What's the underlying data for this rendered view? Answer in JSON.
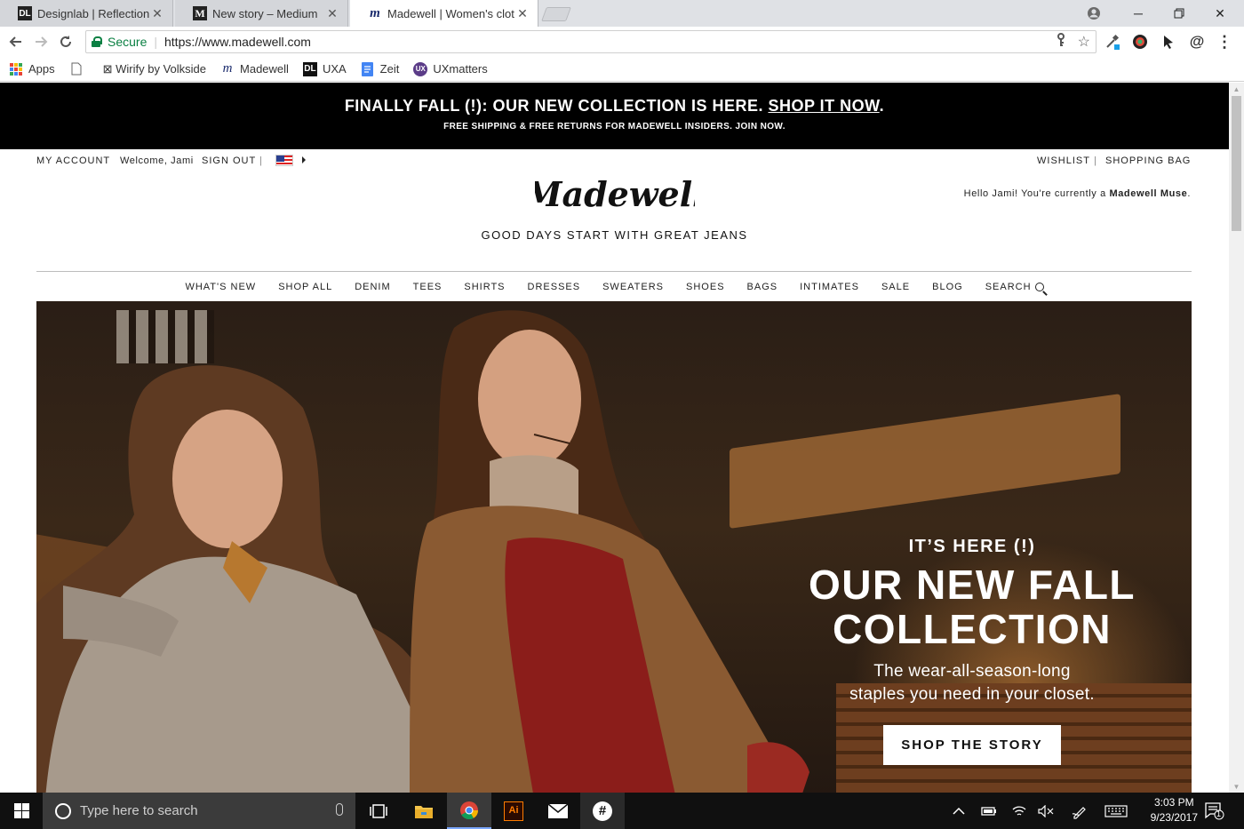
{
  "browser": {
    "tabs": [
      {
        "favicon": "DL",
        "title": "Designlab | Reflection po",
        "active": false
      },
      {
        "favicon": "M",
        "title": "New story – Medium",
        "active": false
      },
      {
        "favicon": "m",
        "title": "Madewell | Women's clot",
        "active": true
      }
    ],
    "url_secure": "Secure",
    "url": "https://www.madewell.com",
    "bookmarks": [
      {
        "icon": "apps-icon",
        "label": "Apps"
      },
      {
        "icon": "page-icon",
        "label": ""
      },
      {
        "icon": "wirify-icon",
        "label": "⊠ Wirify by Volkside"
      },
      {
        "icon": "madewell-icon",
        "label": "Madewell"
      },
      {
        "icon": "dl-icon",
        "label": "UXA"
      },
      {
        "icon": "doc-icon",
        "label": "Zeit"
      },
      {
        "icon": "ux-icon",
        "label": "UXmatters"
      }
    ]
  },
  "promo": {
    "line1_prefix": "FINALLY FALL (!): OUR NEW COLLECTION IS HERE. ",
    "line1_link": "SHOP IT NOW",
    "line1_suffix": ".",
    "line2_prefix": "FREE SHIPPING & FREE RETURNS FOR MADEWELL INSIDERS. ",
    "line2_link": "JOIN NOW",
    "line2_suffix": "."
  },
  "utility": {
    "my_account": "MY ACCOUNT",
    "welcome": "Welcome, Jami",
    "sign_out": "SIGN OUT",
    "divider": "|",
    "wishlist": "WISHLIST",
    "shopping_bag": "SHOPPING BAG"
  },
  "brand": {
    "logo_text": "Madewell",
    "tagline": "GOOD DAYS START WITH GREAT JEANS",
    "muse_prefix": "Hello Jami! You're currently a ",
    "muse_status": "Madewell Muse",
    "muse_suffix": "."
  },
  "nav": [
    "WHAT'S NEW",
    "SHOP ALL",
    "DENIM",
    "TEES",
    "SHIRTS",
    "DRESSES",
    "SWEATERS",
    "SHOES",
    "BAGS",
    "INTIMATES",
    "SALE",
    "BLOG"
  ],
  "nav_search": "SEARCH",
  "hero": {
    "kicker": "IT’S HERE (!)",
    "headline_1": "OUR NEW FALL",
    "headline_2": "COLLECTION",
    "sub_1": "The wear-all-season-long",
    "sub_2": "staples you need in your closet.",
    "cta": "SHOP THE STORY"
  },
  "taskbar": {
    "search_placeholder": "Type here to search",
    "time": "3:03 PM",
    "date": "9/23/2017",
    "notifications": "1"
  },
  "colors": {
    "promo_bg": "#000000",
    "secure_green": "#0b8043",
    "taskbar_bg": "#101010"
  }
}
